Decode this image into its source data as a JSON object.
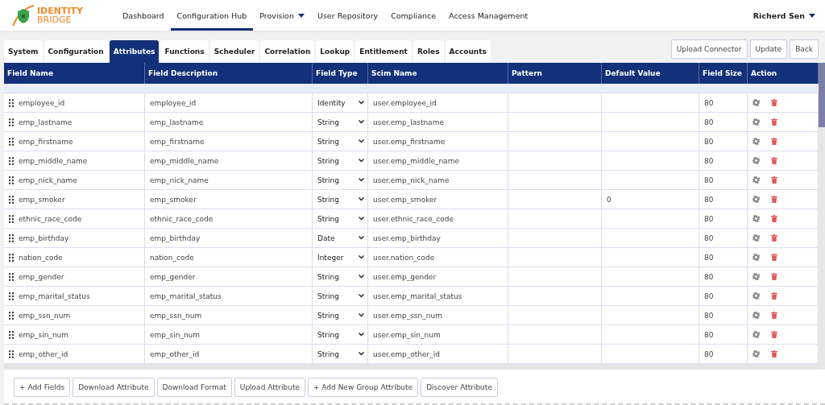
{
  "logo": {
    "line1": "IDENTITY",
    "line2": "BRIDGE"
  },
  "nav": [
    {
      "label": "Dashboard",
      "selected": false,
      "dropdown": false
    },
    {
      "label": "Configuration Hub",
      "selected": true,
      "dropdown": false
    },
    {
      "label": "Provision",
      "selected": false,
      "dropdown": true
    },
    {
      "label": "User Repository",
      "selected": false,
      "dropdown": false
    },
    {
      "label": "Compliance",
      "selected": false,
      "dropdown": false
    },
    {
      "label": "Access Management",
      "selected": false,
      "dropdown": false
    }
  ],
  "user": {
    "name": "Richerd Sen"
  },
  "tabs": [
    {
      "label": "System",
      "selected": false
    },
    {
      "label": "Configuration",
      "selected": false
    },
    {
      "label": "Attributes",
      "selected": true
    },
    {
      "label": "Functions",
      "selected": false
    },
    {
      "label": "Scheduler",
      "selected": false
    },
    {
      "label": "Correlation",
      "selected": false
    },
    {
      "label": "Lookup",
      "selected": false
    },
    {
      "label": "Entitlement",
      "selected": false
    },
    {
      "label": "Roles",
      "selected": false
    },
    {
      "label": "Accounts",
      "selected": false
    }
  ],
  "top_buttons": [
    "Upload Connector",
    "Update",
    "Back"
  ],
  "table": {
    "columns": [
      "Field Name",
      "Field Description",
      "Field Type",
      "Scim Name",
      "Pattern",
      "Default Value",
      "Field Size",
      "Action"
    ],
    "rows": [
      {
        "name": "employee_id",
        "description": "employee_id",
        "type": "Identity",
        "scim": "user.employee_id",
        "size": "80"
      },
      {
        "name": "emp_lastname",
        "description": "emp_lastname",
        "type": "String",
        "scim": "user.emp_lastname",
        "size": "80"
      },
      {
        "name": "emp_firstname",
        "description": "emp_firstname",
        "type": "String",
        "scim": "user.emp_firstname",
        "size": "80"
      },
      {
        "name": "emp_middle_name",
        "description": "emp_middle_name",
        "type": "String",
        "scim": "user.emp_middle_name",
        "size": "80"
      },
      {
        "name": "emp_nick_name",
        "description": "emp_nick_name",
        "type": "String",
        "scim": "user.emp_nick_name",
        "size": "80"
      },
      {
        "name": "emp_smoker",
        "description": "emp_smoker",
        "type": "String",
        "scim": "user.emp_smoker",
        "default": "0",
        "size": "80"
      },
      {
        "name": "ethnic_race_code",
        "description": "ethnic_race_code",
        "type": "String",
        "scim": "user.ethnic_race_code",
        "size": "80"
      },
      {
        "name": "emp_birthday",
        "description": "emp_birthday",
        "type": "Date",
        "scim": "user.emp_birthday",
        "size": "80"
      },
      {
        "name": "nation_code",
        "description": "nation_code",
        "type": "Integer",
        "scim": "user.nation_code",
        "size": "80"
      },
      {
        "name": "emp_gender",
        "description": "emp_gender",
        "type": "String",
        "scim": "user.emp_gender",
        "size": "80"
      },
      {
        "name": "emp_marital_status",
        "description": "emp_marital_status",
        "type": "String",
        "scim": "user.emp_marital_status",
        "size": "80"
      },
      {
        "name": "emp_ssn_num",
        "description": "emp_ssn_num",
        "type": "String",
        "scim": "user.emp_ssn_num",
        "size": "80"
      },
      {
        "name": "emp_sin_num",
        "description": "emp_sin_num",
        "type": "String",
        "scim": "user.emp_sin_num",
        "size": "80"
      },
      {
        "name": "emp_other_id",
        "description": "emp_other_id",
        "type": "String",
        "scim": "user.emp_other_id",
        "size": "80"
      }
    ]
  },
  "bottom_buttons": [
    "+ Add Fields",
    "Download Attribute",
    "Download Format",
    "Upload Attribute",
    "+ Add New Group Attribute",
    "Discover Attribute"
  ]
}
